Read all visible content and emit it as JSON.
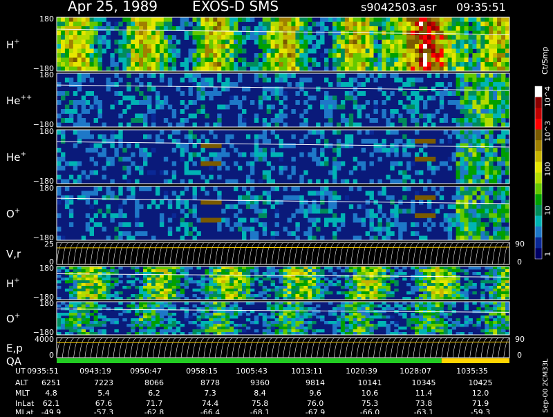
{
  "header": {
    "date": "Apr 25, 1989",
    "instrument": "EXOS-D SMS",
    "file": "s9042503.asr",
    "time": "09:35:51"
  },
  "colorbar": {
    "unit": "Ct/Smp",
    "ticks": [
      "10^4",
      "10^3",
      "100",
      "10",
      "1"
    ],
    "colors": [
      "#ffffff",
      "#8b0000",
      "#c00000",
      "#ff0000",
      "#7a5a00",
      "#a08000",
      "#c8b400",
      "#e6e600",
      "#b4dc00",
      "#64c800",
      "#00a000",
      "#008c5a",
      "#00b4b4",
      "#1e78c8",
      "#0a2896",
      "#000064"
    ]
  },
  "footer": {
    "row_labels": [
      "UT",
      "ALT",
      "MLT",
      "InLat",
      "MLat"
    ],
    "columns": [
      {
        "UT": "0935:51",
        "ALT": "6251",
        "MLT": "4.8",
        "InLat": "62.1",
        "MLat": "-49.9"
      },
      {
        "UT": "0943:19",
        "ALT": "7223",
        "MLT": "5.4",
        "InLat": "67.6",
        "MLat": "-57.3"
      },
      {
        "UT": "0950:47",
        "ALT": "8066",
        "MLT": "6.2",
        "InLat": "71.7",
        "MLat": "-62.8"
      },
      {
        "UT": "0958:15",
        "ALT": "8778",
        "MLT": "7.3",
        "InLat": "74.4",
        "MLat": "-66.4"
      },
      {
        "UT": "1005:43",
        "ALT": "9360",
        "MLT": "8.4",
        "InLat": "75.8",
        "MLat": "-68.1"
      },
      {
        "UT": "1013:11",
        "ALT": "9814",
        "MLT": "9.6",
        "InLat": "76.0",
        "MLat": "-67.9"
      },
      {
        "UT": "1020:39",
        "ALT": "10141",
        "MLT": "10.6",
        "InLat": "75.3",
        "MLat": "-66.0"
      },
      {
        "UT": "1028:07",
        "ALT": "10345",
        "MLT": "11.4",
        "InLat": "73.8",
        "MLat": "-63.1"
      },
      {
        "UT": "1035:35",
        "ALT": "10425",
        "MLT": "12.0",
        "InLat": "71.9",
        "MLat": "-59.3"
      }
    ],
    "side_note": "Sep-00 2CM33L"
  },
  "chart_data": {
    "type": "heatmap",
    "title": "Apr 25, 1989   EXOS-D SMS",
    "x_ticks": [
      "0935:51",
      "0943:19",
      "0950:47",
      "0958:15",
      "1005:43",
      "1013:11",
      "1020:39",
      "1028:07",
      "1035:35"
    ],
    "panels": [
      {
        "name": "H+",
        "label": "H",
        "sup": "+",
        "ylim": [
          -180,
          180
        ],
        "yticks": [
          "180",
          "−180"
        ],
        "kind": "spectrogram",
        "base": 0.55
      },
      {
        "name": "He++",
        "label": "He",
        "sup": "++",
        "ylim": [
          -180,
          180
        ],
        "yticks": [
          "180",
          "−180"
        ],
        "kind": "spectrogram",
        "base": 0.12
      },
      {
        "name": "He+",
        "label": "He",
        "sup": "+",
        "ylim": [
          -180,
          180
        ],
        "yticks": [
          "180",
          "−180"
        ],
        "kind": "spectrogram",
        "base": 0.1
      },
      {
        "name": "O+",
        "label": "O",
        "sup": "+",
        "ylim": [
          -180,
          180
        ],
        "yticks": [
          "180",
          "−180"
        ],
        "kind": "spectrogram",
        "base": 0.12
      },
      {
        "name": "V,r",
        "label": "V,r",
        "sup": "",
        "ylim": [
          0,
          25
        ],
        "yticks": [
          "25",
          "0"
        ],
        "right_ticks": [
          "90",
          "0"
        ],
        "kind": "lines"
      },
      {
        "name": "H+ (2)",
        "label": "H",
        "sup": "+",
        "ylim": [
          -180,
          180
        ],
        "yticks": [
          "180",
          "−180"
        ],
        "kind": "spectrogram",
        "base": 0.45
      },
      {
        "name": "O+ (2)",
        "label": "O",
        "sup": "+",
        "ylim": [
          -180,
          180
        ],
        "yticks": [
          "180",
          "−180"
        ],
        "kind": "spectrogram",
        "base": 0.3
      },
      {
        "name": "E,p",
        "label": "E,p",
        "sup": "",
        "ylim": [
          0,
          4000
        ],
        "yticks": [
          "4000",
          "0"
        ],
        "right_ticks": [
          "90",
          "0"
        ],
        "kind": "lines"
      },
      {
        "name": "QA",
        "label": "QA",
        "sup": "",
        "kind": "qa"
      }
    ]
  }
}
